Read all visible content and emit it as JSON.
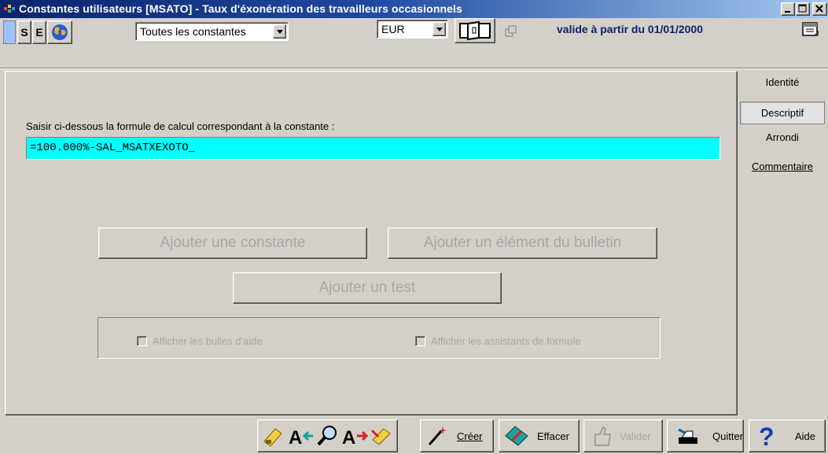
{
  "window": {
    "title": "Constantes utilisateurs  [MSATO] - Taux d'éxonération des travailleurs occasionnels"
  },
  "toolbar": {
    "mode_buttons": [
      "S",
      "E"
    ],
    "filter_combo": {
      "value": "Toutes les constantes"
    },
    "currency_combo": {
      "value": "EUR"
    },
    "valid_from": "valide à partir du 01/01/2000"
  },
  "main": {
    "formula_label": "Saisir ci-dessous la formule de calcul correspondant à la constante :",
    "formula_value": "=100.000%-SAL_MSATXEXOTO_",
    "buttons": {
      "add_constant": "Ajouter une constante",
      "add_element": "Ajouter un élément du bulletin",
      "add_test": "Ajouter un test"
    },
    "options": {
      "show_help": "Afficher les bulles d'aide",
      "show_assistants": "Afficher les assistants de formule"
    }
  },
  "tabs": [
    "Identité",
    "Descriptif",
    "Arrondi",
    "Commentaire"
  ],
  "active_tab": "Descriptif",
  "bottom": {
    "create": "Créer",
    "erase": "Effacer",
    "validate": "Valider",
    "quit": "Quitter",
    "help": "Aide"
  }
}
